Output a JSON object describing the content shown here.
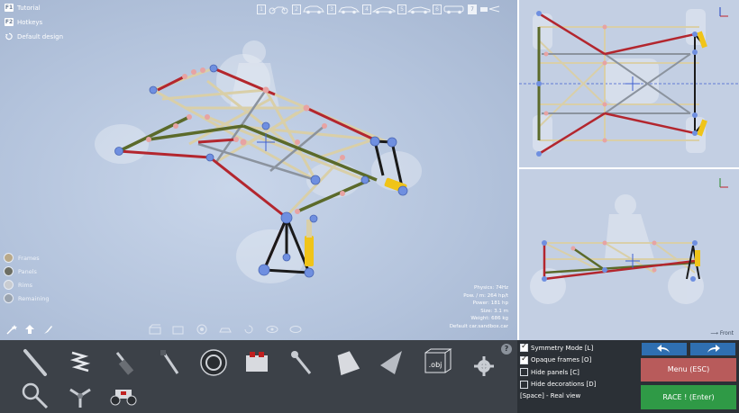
{
  "top_menu": {
    "tutorial": {
      "key": "F1",
      "label": "Tutorial"
    },
    "hotkeys": {
      "key": "F2",
      "label": "Hotkeys"
    },
    "default_design": {
      "label": "Default design"
    }
  },
  "car_modes": [
    {
      "num": "1",
      "active": false
    },
    {
      "num": "2",
      "active": false
    },
    {
      "num": "3",
      "active": false
    },
    {
      "num": "4",
      "active": false
    },
    {
      "num": "5",
      "active": false
    },
    {
      "num": "6",
      "active": false
    },
    {
      "num": "7",
      "active": true
    }
  ],
  "stats": {
    "physics": "Physics: 74Hz",
    "pow_m": "Pow. / m: 264 hp/t",
    "power": "Power: 181 hp",
    "size": "Size: 3.1 m",
    "weight": "Weight: 686 kg",
    "file": "Default car.sandbox.car"
  },
  "legend": {
    "frames": "Frames",
    "panels": "Panels",
    "rims": "Rims",
    "remaining": "Remaining",
    "colors": {
      "frames": "#b9a98a",
      "panels": "#6d6e63",
      "rims": "#c9ccd1",
      "remaining": "#9aa3ae"
    }
  },
  "side_views": {
    "front_label": "Front"
  },
  "options": {
    "symmetry": {
      "label": "Symmetry Mode [L]",
      "checked": true
    },
    "opaque": {
      "label": "Opaque frames [O]",
      "checked": true
    },
    "hide_panels": {
      "label": "Hide panels [C]",
      "checked": false
    },
    "hide_decorations": {
      "label": "Hide decorations [D]",
      "checked": false
    },
    "real_view": "[Space] - Real view"
  },
  "actions": {
    "menu": "Menu (ESC)",
    "race": "RACE ! (Enter)"
  },
  "toolbar": {
    "help": "?",
    "obj_label": ".obj",
    "parts": [
      "rod-icon",
      "spring-icon",
      "damper-icon",
      "tie-rod-icon",
      "wheel-icon",
      "engine-icon",
      "ball-joint-icon",
      "pipe-icon",
      "cone-icon",
      "obj-import-icon",
      "gear-icon",
      "steering-wheel-icon",
      "rotor-icon",
      "buggy-icon"
    ]
  },
  "colors": {
    "rod_tan": "#d9cfa8",
    "rod_red": "#b3262e",
    "rod_green": "#5b6a2a",
    "rod_black": "#1a1a1a",
    "node_blue": "#6f8fe0",
    "node_pink": "#e7a3a3",
    "spring_yellow": "#f0c419",
    "menu_red": "#b85b5b",
    "race_green": "#2f9a46",
    "undo_blue": "#2f6fb1"
  }
}
